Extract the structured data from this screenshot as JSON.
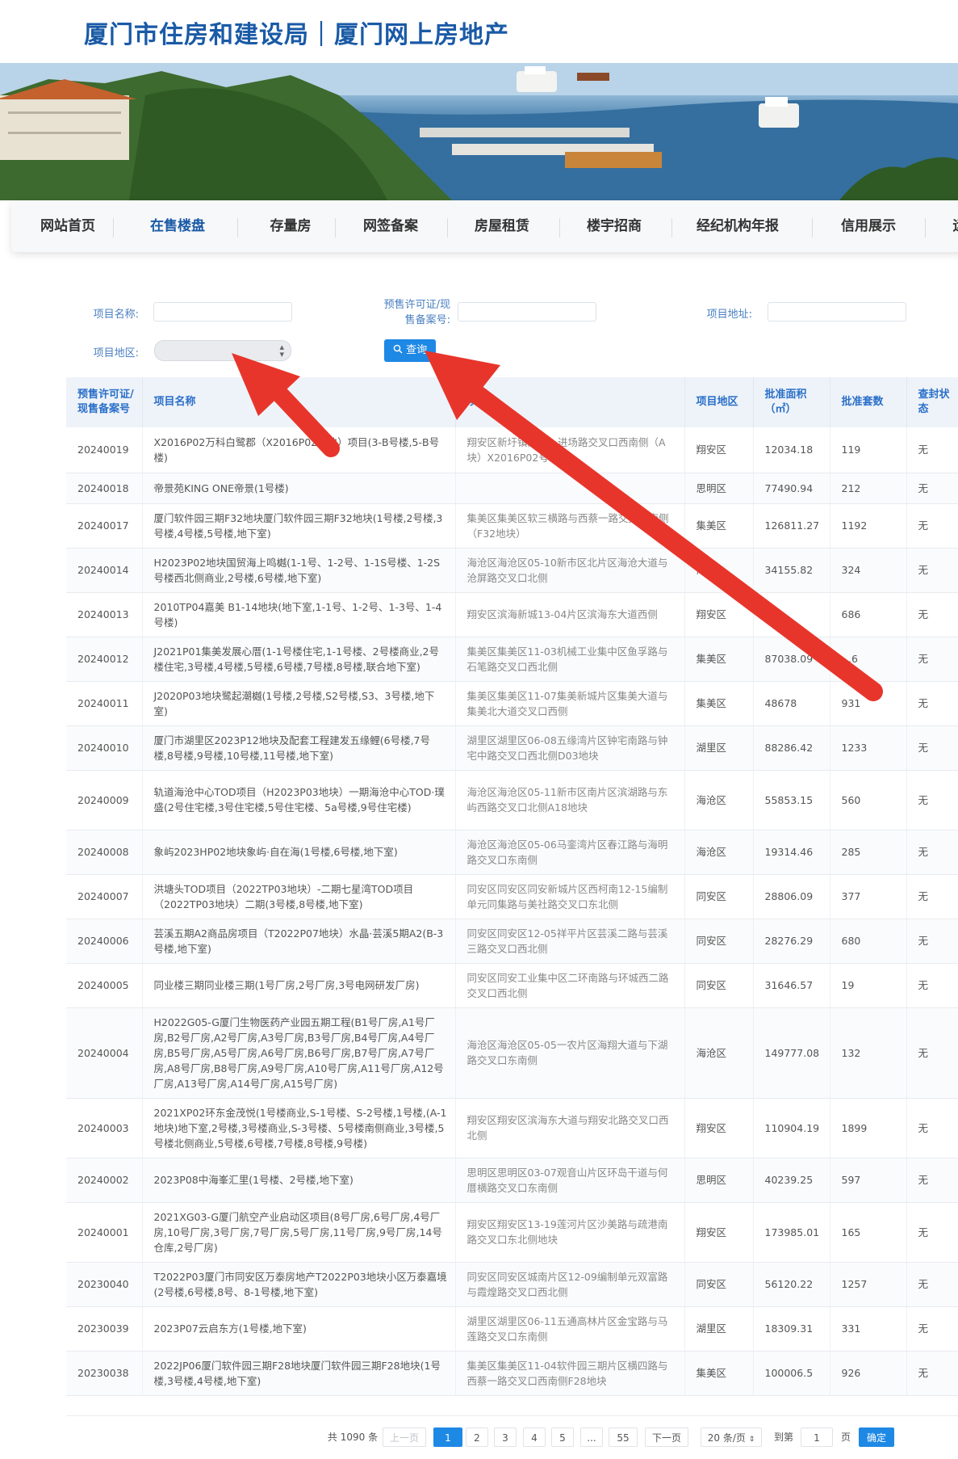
{
  "site": {
    "title": "厦门市住房和建设局｜厦门网上房地产"
  },
  "nav": {
    "items": [
      "网站首页",
      "在售楼盘",
      "存量房",
      "网签备案",
      "房屋租赁",
      "楼宇招商",
      "经纪机构年报",
      "信用展示",
      "运"
    ],
    "active_index": 1
  },
  "search": {
    "name_label": "项目名称:",
    "permit_label_1": "预售许可证/现",
    "permit_label_2": "售备案号:",
    "address_label": "项目地址:",
    "district_label": "项目地区:",
    "button_label": "查询",
    "name_value": "",
    "permit_value": "",
    "address_value": "",
    "district_value": ""
  },
  "table": {
    "headers": {
      "permit": "预售许可证/现售备案号",
      "name": "项目名称",
      "address": "项目",
      "district": "项目地区",
      "area": "批准面积（㎡）",
      "units": "批准套数",
      "seal": "查封状态"
    },
    "rows": [
      {
        "permit": "20240019",
        "name": "X2016P02万科白鹭郡（X2016P02地块）项目(3-B号楼,5-B号楼)",
        "address": "翔安区新圩镇同新…进场路交叉口西南侧（A块）X2016P02号…",
        "district": "翔安区",
        "area": "12034.18",
        "units": "119",
        "seal": "无"
      },
      {
        "permit": "20240018",
        "name": "帝景苑KING ONE帝景(1号楼)",
        "address": "",
        "district": "思明区",
        "area": "77490.94",
        "units": "212",
        "seal": "无"
      },
      {
        "permit": "20240017",
        "name": "厦门软件园三期F32地块厦门软件园三期F32地块(1号楼,2号楼,3号楼,4号楼,5号楼,地下室)",
        "address": "集美区集美区软三横路与西蔡一路交叉…南侧（F32地块）",
        "district": "集美区",
        "area": "126811.27",
        "units": "1192",
        "seal": "无"
      },
      {
        "permit": "20240014",
        "name": "H2023P02地块国贸海上鸣樾(1-1号、1-2号、1-1S号楼、1-2S号楼西北侧商业,2号楼,6号楼,地下室)",
        "address": "海沧区海沧区05-10新市区北片区海沧大道与沧屏路交叉口北侧",
        "district": "海沧…",
        "area": "34155.82",
        "units": "324",
        "seal": "无"
      },
      {
        "permit": "20240013",
        "name": "2010TP04嘉美 B1-14地块(地下室,1-1号、1-2号、1-3号、1-4号楼)",
        "address": "翔安区滨海新城13-04片区滨海东大道西侧",
        "district": "翔安区",
        "area": "6…",
        "units": "686",
        "seal": "无"
      },
      {
        "permit": "20240012",
        "name": "J2021P01集美发展心厝(1-1号楼住宅,1-1号楼、2号楼商业,2号楼住宅,3号楼,4号楼,5号楼,6号楼,7号楼,8号楼,联合地下室)",
        "address": "集美区集美区11-03机械工业集中区鱼孚路与石笔路交叉口西北侧",
        "district": "集美区",
        "area": "87038.09",
        "units": "…6",
        "seal": "无"
      },
      {
        "permit": "20240011",
        "name": "J2020P03地块鹭起潮樾(1号楼,2号楼,S2号楼,S3、3号楼,地下室)",
        "address": "集美区集美区11-07集美新城片区集美大道与集美北大道交叉口西侧",
        "district": "集美区",
        "area": "48678",
        "units": "931",
        "seal": "无"
      },
      {
        "permit": "20240010",
        "name": "厦门市湖里区2023P12地块及配套工程建发五缘鲤(6号楼,7号楼,8号楼,9号楼,10号楼,11号楼,地下室)",
        "address": "湖里区湖里区06-08五缘湾片区钟宅南路与钟宅中路交叉口西北侧D03地块",
        "district": "湖里区",
        "area": "88286.42",
        "units": "1233",
        "seal": "无"
      },
      {
        "permit": "20240009",
        "name": "轨道海沧中心TOD项目（H2023P03地块）一期海沧中心TOD·璞盛(2号住宅楼,3号住宅楼,5号住宅楼、5a号楼,9号住宅楼)",
        "address": "海沧区海沧区05-11新市区南片区滨湖路与东屿西路交叉口北侧A18地块",
        "district": "海沧区",
        "area": "55853.15",
        "units": "560",
        "seal": "无"
      },
      {
        "permit": "20240008",
        "name": "象屿2023HP02地块象屿·自在海(1号楼,6号楼,地下室)",
        "address": "海沧区海沧区05-06马銮湾片区春江路与海明路交叉口东南侧",
        "district": "海沧区",
        "area": "19314.46",
        "units": "285",
        "seal": "无"
      },
      {
        "permit": "20240007",
        "name": "洪塘头TOD项目（2022TP03地块）-二期七星湾TOD项目（2022TP03地块）二期(3号楼,8号楼,地下室)",
        "address": "同安区同安区同安新城片区西柯南12-15编制单元同集路与美社路交叉口东北侧",
        "district": "同安区",
        "area": "28806.09",
        "units": "377",
        "seal": "无"
      },
      {
        "permit": "20240006",
        "name": "芸溪五期A2商品房项目（T2022P07地块）水晶·芸溪5期A2(B-3号楼,地下室)",
        "address": "同安区同安区12-05祥平片区芸溪二路与芸溪三路交叉口西北侧",
        "district": "同安区",
        "area": "28276.29",
        "units": "680",
        "seal": "无"
      },
      {
        "permit": "20240005",
        "name": "同业楼三期同业楼三期(1号厂房,2号厂房,3号电网研发厂房)",
        "address": "同安区同安工业集中区二环南路与环城西二路交叉口西北侧",
        "district": "同安区",
        "area": "31646.57",
        "units": "19",
        "seal": "无"
      },
      {
        "permit": "20240004",
        "name": "H2022G05-G厦门生物医药产业园五期工程(B1号厂房,A1号厂房,B2号厂房,A2号厂房,A3号厂房,B3号厂房,B4号厂房,A4号厂房,B5号厂房,A5号厂房,A6号厂房,B6号厂房,B7号厂房,A7号厂房,A8号厂房,B8号厂房,A9号厂房,A10号厂房,A11号厂房,A12号厂房,A13号厂房,A14号厂房,A15号厂房)",
        "address": "海沧区海沧区05-05一农片区海翔大道与下湖路交叉口东南侧",
        "district": "海沧区",
        "area": "149777.08",
        "units": "132",
        "seal": "无"
      },
      {
        "permit": "20240003",
        "name": "2021XP02环东金茂悦(1号楼商业,S-1号楼、S-2号楼,1号楼,(A-1地块)地下室,2号楼,3号楼商业,S-3号楼、5号楼南侧商业,3号楼,5号楼北侧商业,5号楼,6号楼,7号楼,8号楼,9号楼)",
        "address": "翔安区翔安区滨海东大道与翔安北路交叉口西北侧",
        "district": "翔安区",
        "area": "110904.19",
        "units": "1899",
        "seal": "无"
      },
      {
        "permit": "20240002",
        "name": "2023P08中海峯汇里(1号楼、2号楼,地下室)",
        "address": "思明区思明区03-07观音山片区环岛干道与何厝横路交叉口东南侧",
        "district": "思明区",
        "area": "40239.25",
        "units": "597",
        "seal": "无"
      },
      {
        "permit": "20240001",
        "name": "2021XG03-G厦门航空产业启动区项目(8号厂房,6号厂房,4号厂房,10号厂房,3号厂房,7号厂房,5号厂房,11号厂房,9号厂房,14号仓库,2号厂房)",
        "address": "翔安区翔安区13-19莲河片区沙美路与疏港南路交叉口东北侧地块",
        "district": "翔安区",
        "area": "173985.01",
        "units": "165",
        "seal": "无"
      },
      {
        "permit": "20230040",
        "name": "T2022P03厦门市同安区万泰房地产T2022P03地块小区万泰嘉境(2号楼,6号楼,8号、8-1号楼,地下室)",
        "address": "同安区同安区城南片区12-09编制单元双富路与霞煌路交叉口西北侧",
        "district": "同安区",
        "area": "56120.22",
        "units": "1257",
        "seal": "无"
      },
      {
        "permit": "20230039",
        "name": "2023P07云启东方(1号楼,地下室)",
        "address": "湖里区湖里区06-11五通高林片区金宝路与马莲路交叉口东南侧",
        "district": "湖里区",
        "area": "18309.31",
        "units": "331",
        "seal": "无"
      },
      {
        "permit": "20230038",
        "name": "2022JP06厦门软件园三期F28地块厦门软件园三期F28地块(1号楼,3号楼,4号楼,地下室)",
        "address": "集美区集美区11-04软件园三期片区横四路与西蔡一路交叉口西南侧F28地块",
        "district": "集美区",
        "area": "100006.5",
        "units": "926",
        "seal": "无"
      }
    ]
  },
  "pagination": {
    "total": "共 1090 条",
    "prev": "上一页",
    "pages": [
      "1",
      "2",
      "3",
      "4",
      "5",
      "...",
      "55"
    ],
    "active_page": "1",
    "next": "下一页",
    "page_size": "20 条/页",
    "goto_label": "到第",
    "goto_value": "1",
    "page_unit": "页",
    "confirm": "确定"
  },
  "colors": {
    "brand": "#1a5aa6",
    "accent": "#1e88e5",
    "annotation_arrow": "#e8352b"
  },
  "icons": {
    "search": "search-icon",
    "select_caret": "updown-caret-icon"
  }
}
